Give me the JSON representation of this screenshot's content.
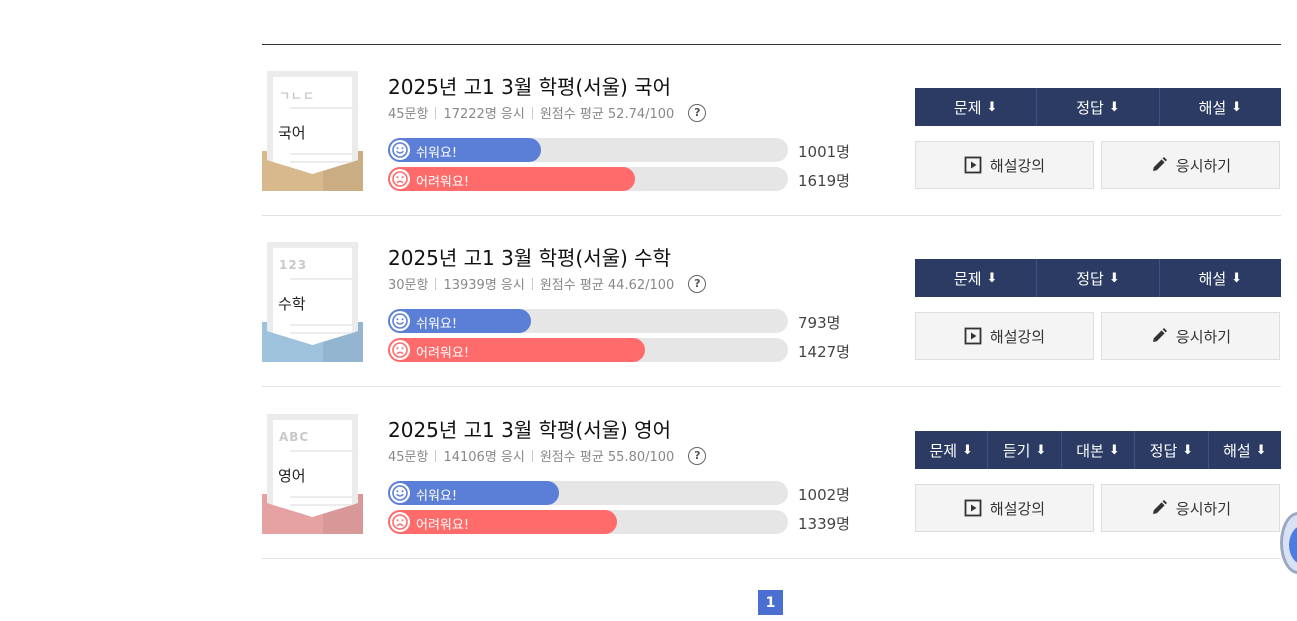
{
  "exams": [
    {
      "thumb_caption": "ㄱㄴㄷ",
      "subject": "국어",
      "thumb_color": "#d8b88d",
      "title": "2025년 고1 3월 학평(서울) 국어",
      "questions": "45문항",
      "takers": "17222명 응시",
      "average": "원점수 평균 52.74/100",
      "easy_label": "쉬워요!",
      "easy_count": "1001명",
      "easy_ratio": 0.382,
      "hard_label": "어려워요!",
      "hard_count": "1619명",
      "hard_ratio": 0.618,
      "downloads": [
        "문제",
        "정답",
        "해설"
      ],
      "lecture": "해설강의",
      "take_test": "응시하기"
    },
    {
      "thumb_caption": "123",
      "subject": "수학",
      "thumb_color": "#9ec1dc",
      "title": "2025년 고1 3월 학평(서울) 수학",
      "questions": "30문항",
      "takers": "13939명 응시",
      "average": "원점수 평균 44.62/100",
      "easy_label": "쉬워요!",
      "easy_count": "793명",
      "easy_ratio": 0.357,
      "hard_label": "어려워요!",
      "hard_count": "1427명",
      "hard_ratio": 0.643,
      "downloads": [
        "문제",
        "정답",
        "해설"
      ],
      "lecture": "해설강의",
      "take_test": "응시하기"
    },
    {
      "thumb_caption": "ABC",
      "subject": "영어",
      "thumb_color": "#e6a2a2",
      "title": "2025년 고1 3월 학평(서울) 영어",
      "questions": "45문항",
      "takers": "14106명 응시",
      "average": "원점수 평균 55.80/100",
      "easy_label": "쉬워요!",
      "easy_count": "1002명",
      "easy_ratio": 0.428,
      "hard_label": "어려워요!",
      "hard_count": "1339명",
      "hard_ratio": 0.572,
      "downloads": [
        "문제",
        "듣기",
        "대본",
        "정답",
        "해설"
      ],
      "lecture": "해설강의",
      "take_test": "응시하기"
    }
  ],
  "help_glyph": "?",
  "download_glyph": "⬇",
  "pagination": {
    "current": "1"
  },
  "colors": {
    "navy": "#2b3b63",
    "easy": "#5b7fd6",
    "hard": "#ff6b6b",
    "page": "#4a6fd0"
  }
}
